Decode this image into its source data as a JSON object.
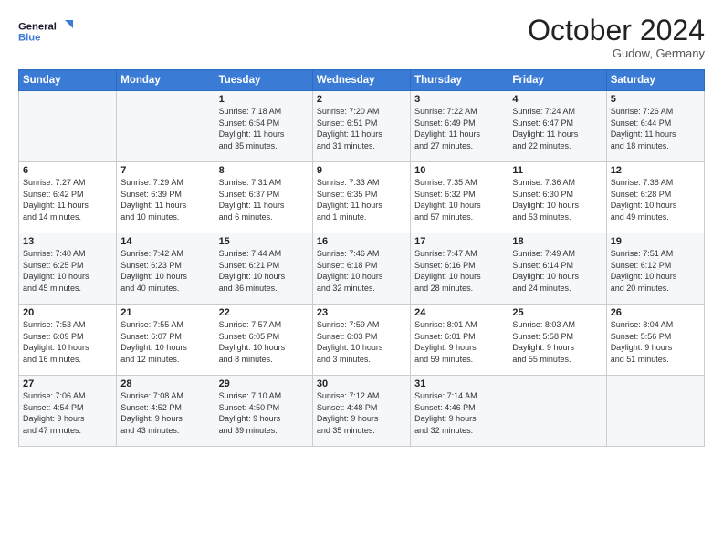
{
  "logo": {
    "line1": "General",
    "line2": "Blue"
  },
  "header": {
    "month": "October 2024",
    "location": "Gudow, Germany"
  },
  "weekdays": [
    "Sunday",
    "Monday",
    "Tuesday",
    "Wednesday",
    "Thursday",
    "Friday",
    "Saturday"
  ],
  "weeks": [
    [
      {
        "day": "",
        "info": ""
      },
      {
        "day": "",
        "info": ""
      },
      {
        "day": "1",
        "info": "Sunrise: 7:18 AM\nSunset: 6:54 PM\nDaylight: 11 hours\nand 35 minutes."
      },
      {
        "day": "2",
        "info": "Sunrise: 7:20 AM\nSunset: 6:51 PM\nDaylight: 11 hours\nand 31 minutes."
      },
      {
        "day": "3",
        "info": "Sunrise: 7:22 AM\nSunset: 6:49 PM\nDaylight: 11 hours\nand 27 minutes."
      },
      {
        "day": "4",
        "info": "Sunrise: 7:24 AM\nSunset: 6:47 PM\nDaylight: 11 hours\nand 22 minutes."
      },
      {
        "day": "5",
        "info": "Sunrise: 7:26 AM\nSunset: 6:44 PM\nDaylight: 11 hours\nand 18 minutes."
      }
    ],
    [
      {
        "day": "6",
        "info": "Sunrise: 7:27 AM\nSunset: 6:42 PM\nDaylight: 11 hours\nand 14 minutes."
      },
      {
        "day": "7",
        "info": "Sunrise: 7:29 AM\nSunset: 6:39 PM\nDaylight: 11 hours\nand 10 minutes."
      },
      {
        "day": "8",
        "info": "Sunrise: 7:31 AM\nSunset: 6:37 PM\nDaylight: 11 hours\nand 6 minutes."
      },
      {
        "day": "9",
        "info": "Sunrise: 7:33 AM\nSunset: 6:35 PM\nDaylight: 11 hours\nand 1 minute."
      },
      {
        "day": "10",
        "info": "Sunrise: 7:35 AM\nSunset: 6:32 PM\nDaylight: 10 hours\nand 57 minutes."
      },
      {
        "day": "11",
        "info": "Sunrise: 7:36 AM\nSunset: 6:30 PM\nDaylight: 10 hours\nand 53 minutes."
      },
      {
        "day": "12",
        "info": "Sunrise: 7:38 AM\nSunset: 6:28 PM\nDaylight: 10 hours\nand 49 minutes."
      }
    ],
    [
      {
        "day": "13",
        "info": "Sunrise: 7:40 AM\nSunset: 6:25 PM\nDaylight: 10 hours\nand 45 minutes."
      },
      {
        "day": "14",
        "info": "Sunrise: 7:42 AM\nSunset: 6:23 PM\nDaylight: 10 hours\nand 40 minutes."
      },
      {
        "day": "15",
        "info": "Sunrise: 7:44 AM\nSunset: 6:21 PM\nDaylight: 10 hours\nand 36 minutes."
      },
      {
        "day": "16",
        "info": "Sunrise: 7:46 AM\nSunset: 6:18 PM\nDaylight: 10 hours\nand 32 minutes."
      },
      {
        "day": "17",
        "info": "Sunrise: 7:47 AM\nSunset: 6:16 PM\nDaylight: 10 hours\nand 28 minutes."
      },
      {
        "day": "18",
        "info": "Sunrise: 7:49 AM\nSunset: 6:14 PM\nDaylight: 10 hours\nand 24 minutes."
      },
      {
        "day": "19",
        "info": "Sunrise: 7:51 AM\nSunset: 6:12 PM\nDaylight: 10 hours\nand 20 minutes."
      }
    ],
    [
      {
        "day": "20",
        "info": "Sunrise: 7:53 AM\nSunset: 6:09 PM\nDaylight: 10 hours\nand 16 minutes."
      },
      {
        "day": "21",
        "info": "Sunrise: 7:55 AM\nSunset: 6:07 PM\nDaylight: 10 hours\nand 12 minutes."
      },
      {
        "day": "22",
        "info": "Sunrise: 7:57 AM\nSunset: 6:05 PM\nDaylight: 10 hours\nand 8 minutes."
      },
      {
        "day": "23",
        "info": "Sunrise: 7:59 AM\nSunset: 6:03 PM\nDaylight: 10 hours\nand 3 minutes."
      },
      {
        "day": "24",
        "info": "Sunrise: 8:01 AM\nSunset: 6:01 PM\nDaylight: 9 hours\nand 59 minutes."
      },
      {
        "day": "25",
        "info": "Sunrise: 8:03 AM\nSunset: 5:58 PM\nDaylight: 9 hours\nand 55 minutes."
      },
      {
        "day": "26",
        "info": "Sunrise: 8:04 AM\nSunset: 5:56 PM\nDaylight: 9 hours\nand 51 minutes."
      }
    ],
    [
      {
        "day": "27",
        "info": "Sunrise: 7:06 AM\nSunset: 4:54 PM\nDaylight: 9 hours\nand 47 minutes."
      },
      {
        "day": "28",
        "info": "Sunrise: 7:08 AM\nSunset: 4:52 PM\nDaylight: 9 hours\nand 43 minutes."
      },
      {
        "day": "29",
        "info": "Sunrise: 7:10 AM\nSunset: 4:50 PM\nDaylight: 9 hours\nand 39 minutes."
      },
      {
        "day": "30",
        "info": "Sunrise: 7:12 AM\nSunset: 4:48 PM\nDaylight: 9 hours\nand 35 minutes."
      },
      {
        "day": "31",
        "info": "Sunrise: 7:14 AM\nSunset: 4:46 PM\nDaylight: 9 hours\nand 32 minutes."
      },
      {
        "day": "",
        "info": ""
      },
      {
        "day": "",
        "info": ""
      }
    ]
  ]
}
